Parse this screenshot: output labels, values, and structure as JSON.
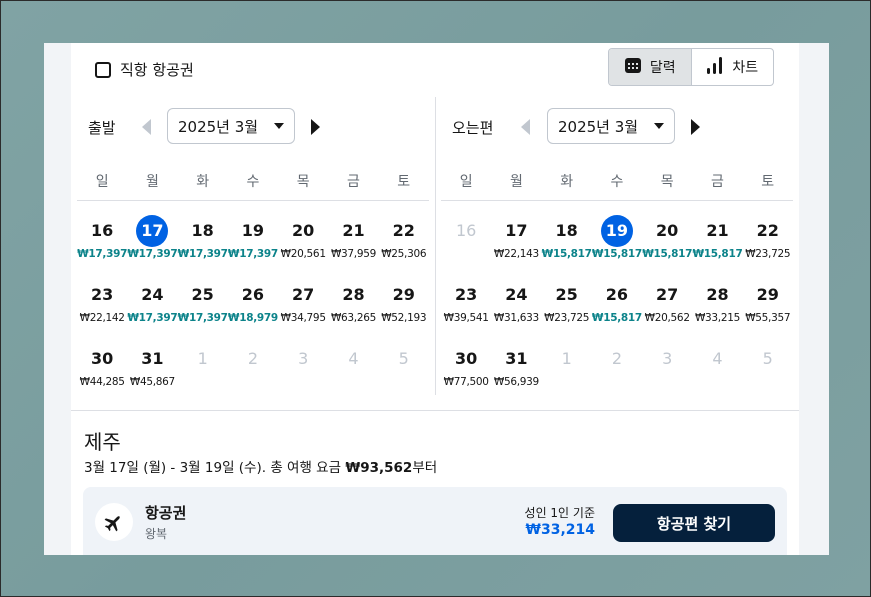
{
  "direct": {
    "label": "직항 항공권"
  },
  "view_toggle": {
    "calendar_label": "달력",
    "chart_label": "차트"
  },
  "weekdays": [
    "일",
    "월",
    "화",
    "수",
    "목",
    "금",
    "토"
  ],
  "outbound": {
    "title": "출발",
    "month": "2025년 3월",
    "weeks": [
      [
        {
          "d": "16",
          "p": "₩17,397",
          "cheap": true
        },
        {
          "d": "17",
          "p": "₩17,397",
          "cheap": true,
          "sel": true
        },
        {
          "d": "18",
          "p": "₩17,397",
          "cheap": true
        },
        {
          "d": "19",
          "p": "₩17,397",
          "cheap": true
        },
        {
          "d": "20",
          "p": "₩20,561"
        },
        {
          "d": "21",
          "p": "₩37,959"
        },
        {
          "d": "22",
          "p": "₩25,306"
        }
      ],
      [
        {
          "d": "23",
          "p": "₩22,142"
        },
        {
          "d": "24",
          "p": "₩17,397",
          "cheap": true
        },
        {
          "d": "25",
          "p": "₩17,397",
          "cheap": true
        },
        {
          "d": "26",
          "p": "₩18,979",
          "cheap": true
        },
        {
          "d": "27",
          "p": "₩34,795"
        },
        {
          "d": "28",
          "p": "₩63,265"
        },
        {
          "d": "29",
          "p": "₩52,193"
        }
      ],
      [
        {
          "d": "30",
          "p": "₩44,285"
        },
        {
          "d": "31",
          "p": "₩45,867"
        },
        {
          "d": "1",
          "muted": true
        },
        {
          "d": "2",
          "muted": true
        },
        {
          "d": "3",
          "muted": true
        },
        {
          "d": "4",
          "muted": true
        },
        {
          "d": "5",
          "muted": true
        }
      ]
    ]
  },
  "return": {
    "title": "오는편",
    "month": "2025년 3월",
    "weeks": [
      [
        {
          "d": "16",
          "muted": true
        },
        {
          "d": "17",
          "p": "₩22,143"
        },
        {
          "d": "18",
          "p": "₩15,817",
          "cheap": true
        },
        {
          "d": "19",
          "p": "₩15,817",
          "cheap": true,
          "sel": true
        },
        {
          "d": "20",
          "p": "₩15,817",
          "cheap": true
        },
        {
          "d": "21",
          "p": "₩15,817",
          "cheap": true
        },
        {
          "d": "22",
          "p": "₩23,725"
        }
      ],
      [
        {
          "d": "23",
          "p": "₩39,541"
        },
        {
          "d": "24",
          "p": "₩31,633"
        },
        {
          "d": "25",
          "p": "₩23,725"
        },
        {
          "d": "26",
          "p": "₩15,817",
          "cheap": true
        },
        {
          "d": "27",
          "p": "₩20,562"
        },
        {
          "d": "28",
          "p": "₩33,215"
        },
        {
          "d": "29",
          "p": "₩55,357"
        }
      ],
      [
        {
          "d": "30",
          "p": "₩77,500"
        },
        {
          "d": "31",
          "p": "₩56,939"
        },
        {
          "d": "1",
          "muted": true
        },
        {
          "d": "2",
          "muted": true
        },
        {
          "d": "3",
          "muted": true
        },
        {
          "d": "4",
          "muted": true
        },
        {
          "d": "5",
          "muted": true
        }
      ]
    ]
  },
  "summary": {
    "destination": "제주",
    "trip_text": "3월 17일 (월) - 3월 19일 (수). 총 여행 요금 ",
    "trip_total": "₩93,562",
    "trip_suffix": "부터"
  },
  "result": {
    "title": "항공권",
    "subtitle": "왕복",
    "basis": "성인 1인 기준",
    "price": "₩33,214",
    "button_label": "항공편 찾기",
    "icon": "airplane-icon"
  },
  "colors": {
    "selected": "#0062e3",
    "cheap": "#0c838a",
    "button": "#05203c"
  }
}
